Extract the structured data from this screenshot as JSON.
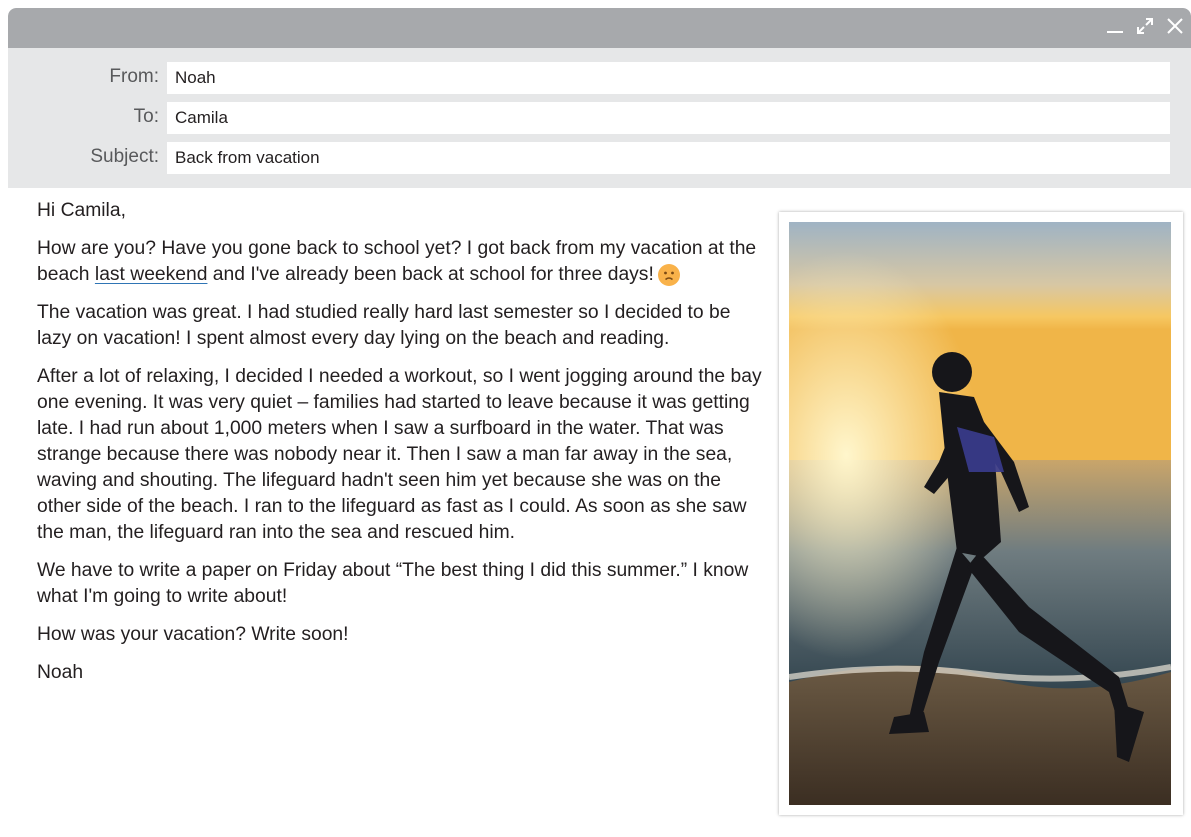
{
  "email": {
    "from_label": "From:",
    "from_value": "Noah",
    "to_label": "To:",
    "to_value": "Camila",
    "subject_label": "Subject:",
    "subject_value": "Back from vacation"
  },
  "body": {
    "greeting": "Hi Camila,",
    "p1_before": "How are you? Have you gone back to school yet? I got back from my vacation at the beach ",
    "p1_link": "last weekend",
    "p1_after": " and I've already been back at school for three days!",
    "p2": "The vacation was great. I had studied really hard last semester so I decided to be lazy on vacation! I spent almost every day lying on the beach and reading.",
    "p3": "After a lot of relaxing, I decided I needed a workout, so I went jogging around the bay one evening. It was very quiet – families had started to leave because it was getting late. I had run about 1,000 meters when I saw a surfboard in the water. That was strange because there was nobody near it. Then I saw a man far away in the sea, waving and shouting. The lifeguard hadn't seen him yet because she was on the other side of the beach. I ran to the lifeguard as fast as I could. As soon as she saw the man, the lifeguard ran into the sea and rescued him.",
    "p4": "We have to write a paper on Friday about “The best thing I did this summer.” I know what I'm going to write about!",
    "p5": "How was your vacation? Write soon!",
    "signature": "Noah"
  },
  "icons": {
    "minimize": "minimize-icon",
    "expand": "expand-icon",
    "close": "close-icon",
    "emoji": "sad-face-icon"
  },
  "colors": {
    "titlebar": "#a7a9ac",
    "header_bg": "#e6e7e8",
    "link_underline": "#2f75b5",
    "emoji": "#f9b24a"
  }
}
